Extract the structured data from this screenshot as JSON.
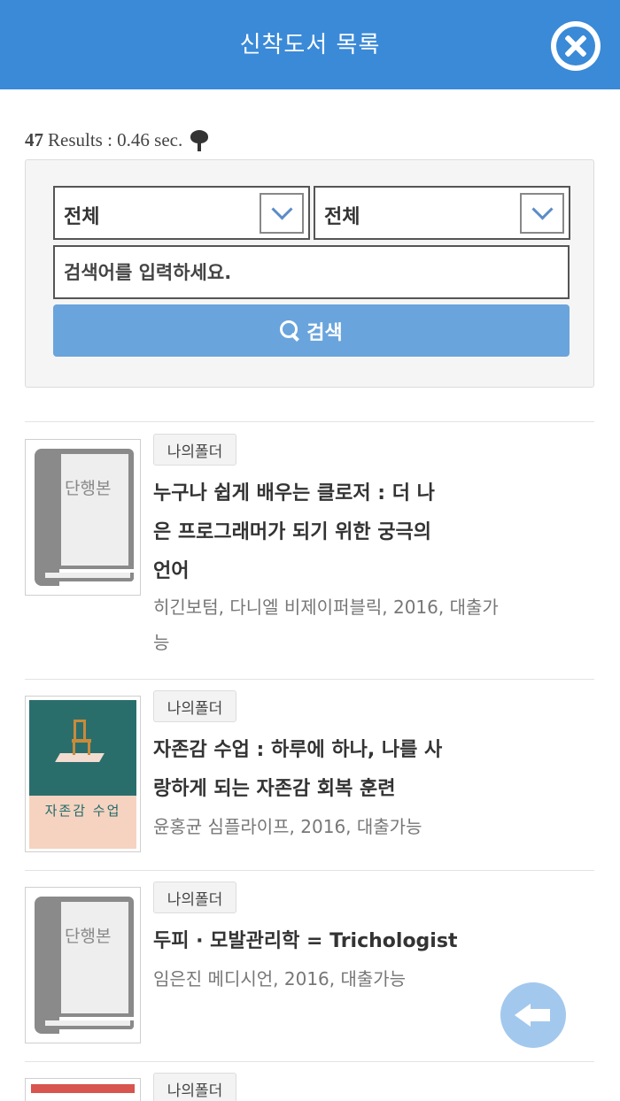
{
  "header": {
    "title": "신착도서 목록",
    "close_icon": "close-icon"
  },
  "results": {
    "count": "47",
    "text": "Results : 0.46 sec.",
    "icon": "tree-icon"
  },
  "search": {
    "select_1": "전체",
    "select_2": "전체",
    "placeholder": "검색어를 입력하세요.",
    "button_label": "검색"
  },
  "books": [
    {
      "tag": "나의폴더",
      "cover_label": "단행본",
      "title": "누구나 쉽게 배우는 클로저 : 더 나은 프로그래머가 되기 위한 궁극의 언어",
      "meta": "히긴보텀, 다니엘 비제이퍼블릭, 2016, 대출가능"
    },
    {
      "tag": "나의폴더",
      "cover_label": "자존감 수업",
      "title": "자존감 수업 : 하루에 하나, 나를 사랑하게 되는 자존감 회복 훈련",
      "meta": "윤홍균 심플라이프, 2016, 대출가능"
    },
    {
      "tag": "나의폴더",
      "cover_label": "단행본",
      "title": "두피 · 모발관리학 = Trichologist",
      "meta": "임은진 메디시언, 2016, 대출가능"
    },
    {
      "tag": "나의폴더"
    }
  ],
  "colors": {
    "header": "#3a8ad8",
    "search_button": "#6aa4dc",
    "fab": "#a3c8ee"
  }
}
